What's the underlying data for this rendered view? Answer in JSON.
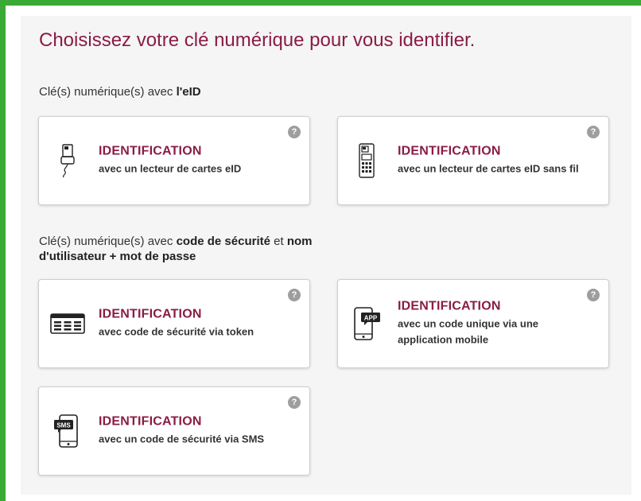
{
  "page": {
    "title": "Choisissez votre clé numérique pour vous identifier."
  },
  "sections": [
    {
      "label_prefix": "Clé(s) numérique(s) avec ",
      "label_bold": "l'eID"
    },
    {
      "label_prefix": "Clé(s) numérique(s) avec ",
      "label_bold_1": "code de sécurité",
      "label_mid": " et ",
      "label_bold_2": "nom d'utilisateur + mot de passe"
    }
  ],
  "cards": [
    {
      "icon": "card-reader-icon",
      "title": "IDENTIFICATION",
      "desc": "avec un lecteur de cartes eID",
      "help": "?"
    },
    {
      "icon": "wireless-card-reader-icon",
      "title": "IDENTIFICATION",
      "desc": "avec un lecteur de cartes eID sans fil",
      "help": "?"
    },
    {
      "icon": "token-icon",
      "title": "IDENTIFICATION",
      "desc": "avec code de sécurité via token",
      "help": "?"
    },
    {
      "icon": "mobile-app-icon",
      "title": "IDENTIFICATION",
      "desc": "avec un code unique via une application mobile",
      "help": "?",
      "icon_label": "APP"
    },
    {
      "icon": "sms-icon",
      "title": "IDENTIFICATION",
      "desc": "avec un code de sécurité via SMS",
      "help": "?",
      "icon_label": "SMS"
    }
  ],
  "colors": {
    "frame_border": "#3aaa35",
    "accent": "#8a1c45",
    "help_badge": "#9e9e9e"
  }
}
